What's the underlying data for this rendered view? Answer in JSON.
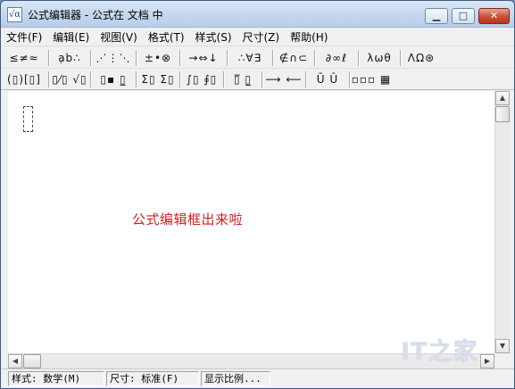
{
  "window": {
    "title": "公式编辑器 - 公式在 文档 中",
    "app_icon": "√α",
    "min_glyph": "▁",
    "max_glyph": "□",
    "close_glyph": "✕"
  },
  "menu": [
    {
      "label": "文件(F)"
    },
    {
      "label": "编辑(E)"
    },
    {
      "label": "视图(V)"
    },
    {
      "label": "格式(T)"
    },
    {
      "label": "样式(S)"
    },
    {
      "label": "尺寸(Z)"
    },
    {
      "label": "帮助(H)"
    }
  ],
  "toolbar_symbols": [
    {
      "label": "≤≠≈"
    },
    {
      "label": "ạb∴"
    },
    {
      "label": "⋰⋮⋱"
    },
    {
      "label": "±•⊗"
    },
    {
      "label": "→⇔↓"
    },
    {
      "label": "∴∀∃"
    },
    {
      "label": "∉∩⊂"
    },
    {
      "label": "∂∞ℓ"
    },
    {
      "label": "λωθ"
    },
    {
      "label": "ΛΩ⊛"
    }
  ],
  "toolbar_templates": [
    {
      "label": "(▯)[▯]"
    },
    {
      "label": "▯⁄▯ √▯"
    },
    {
      "label": "▯▪ ▯̲"
    },
    {
      "label": "Σ▯ Σ▯"
    },
    {
      "label": "∫▯ ∮▯"
    },
    {
      "label": "▯̅ ▯̲"
    },
    {
      "label": "⟶ ⟵"
    },
    {
      "label": "Ū Û"
    },
    {
      "label": "▫▫▫ ▦"
    }
  ],
  "annotation": "公式编辑框出来啦",
  "scrollbar": {
    "up": "▲",
    "down": "▼",
    "left": "◀",
    "right": "▶"
  },
  "status": {
    "style": "样式: 数学(M)",
    "size": "尺寸: 标准(F)",
    "zoom": "显示比例..."
  },
  "watermark": "IT之家"
}
